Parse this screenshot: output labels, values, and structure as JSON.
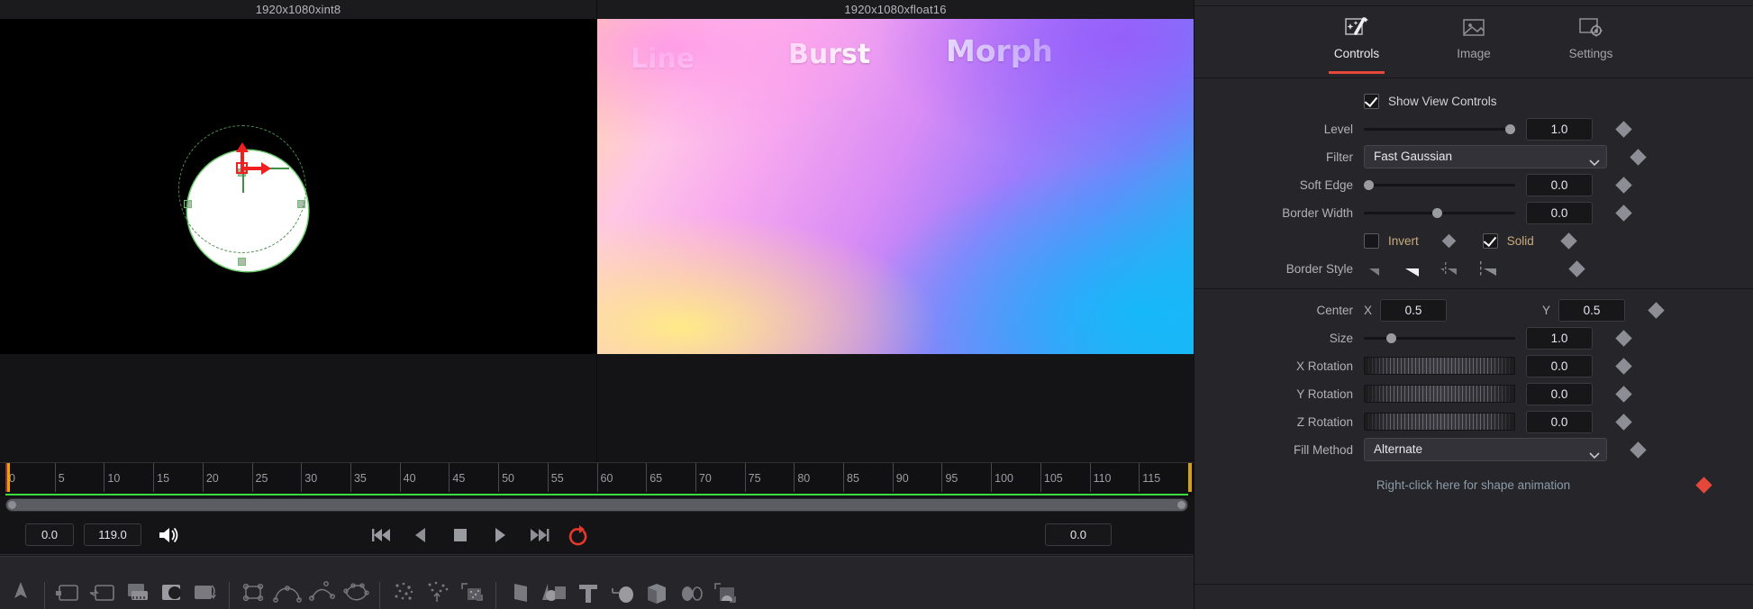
{
  "viewers": {
    "titles": [
      "1920x1080xint8",
      "1920x1080xfloat16"
    ],
    "overlay_labels": [
      "Line",
      "Burst",
      "Morph"
    ]
  },
  "timeline": {
    "tick_labels": [
      "0",
      "5",
      "10",
      "15",
      "20",
      "25",
      "30",
      "35",
      "40",
      "45",
      "50",
      "55",
      "60",
      "65",
      "70",
      "75",
      "80",
      "85",
      "90",
      "95",
      "100",
      "105",
      "110",
      "115"
    ],
    "range_start": 0,
    "range_end": 119,
    "playhead": 0,
    "green_cache_bar": true
  },
  "transport": {
    "in_point": "0.0",
    "out_point": "119.0",
    "current_frame": "0.0",
    "audio_icon": "speaker-icon",
    "buttons": [
      {
        "name": "skip-to-start-button",
        "icon": "skip-back-icon"
      },
      {
        "name": "play-reverse-button",
        "icon": "play-reverse-icon"
      },
      {
        "name": "stop-button",
        "icon": "stop-icon"
      },
      {
        "name": "play-forward-button",
        "icon": "play-forward-icon"
      },
      {
        "name": "skip-to-end-button",
        "icon": "skip-forward-icon"
      },
      {
        "name": "loop-button",
        "icon": "loop-icon",
        "active": true,
        "color": "#e5392b"
      }
    ]
  },
  "inspector": {
    "tabs": [
      {
        "label": "Controls",
        "icon": "magic-wand-icon",
        "active": true
      },
      {
        "label": "Image",
        "icon": "image-icon",
        "active": false
      },
      {
        "label": "Settings",
        "icon": "settings-gear-icon",
        "active": false
      }
    ],
    "accent_color": "#e5483b",
    "show_view_controls": {
      "label": "Show View Controls",
      "checked": true
    },
    "rows": [
      {
        "label": "Level",
        "type": "slider",
        "value": "1.0",
        "knob_pct": 100
      },
      {
        "label": "Filter",
        "type": "combo",
        "value": "Fast Gaussian"
      },
      {
        "label": "Soft Edge",
        "type": "slider",
        "value": "0.0",
        "knob_pct": 0
      },
      {
        "label": "Border Width",
        "type": "slider",
        "value": "0.0",
        "knob_pct": 48
      }
    ],
    "toggles": [
      {
        "label": "Invert",
        "checked": false
      },
      {
        "label": "Solid",
        "checked": true
      }
    ],
    "border_style": {
      "label": "Border Style",
      "selected_index": 1,
      "options": [
        "border-style-solid-flat-icon",
        "border-style-solid-bright-icon",
        "border-style-dashed-small-icon",
        "border-style-dashed-large-icon"
      ]
    },
    "center": {
      "label": "Center",
      "x_label": "X",
      "x": "0.5",
      "y_label": "Y",
      "y": "0.5"
    },
    "size": {
      "label": "Size",
      "value": "1.0",
      "knob_pct": 16
    },
    "rotations": [
      {
        "label": "X Rotation",
        "value": "0.0"
      },
      {
        "label": "Y Rotation",
        "value": "0.0"
      },
      {
        "label": "Z Rotation",
        "value": "0.0"
      }
    ],
    "fill_method": {
      "label": "Fill Method",
      "value": "Alternate"
    },
    "hint": "Right-click here for shape animation"
  },
  "toolstrip": {
    "groups": [
      [
        "cursor-arrow-icon"
      ],
      [
        "media-in-icon",
        "media-out-icon",
        "loader-icon",
        "matte-control-icon",
        "transform-icon"
      ],
      [
        "rect-mask-icon",
        "ellipse-mask-icon",
        "bspline-mask-icon",
        "polygon-mask-icon"
      ],
      [
        "particle-emitter-icon",
        "particle-spawn-icon",
        "particle-region-icon"
      ],
      [
        "plane-3d-icon",
        "shape-3d-icon",
        "text-3d-icon",
        "camera-3d-icon",
        "cube-3d-icon",
        "renderer-3d-icon",
        "image-plane-icon"
      ]
    ]
  }
}
